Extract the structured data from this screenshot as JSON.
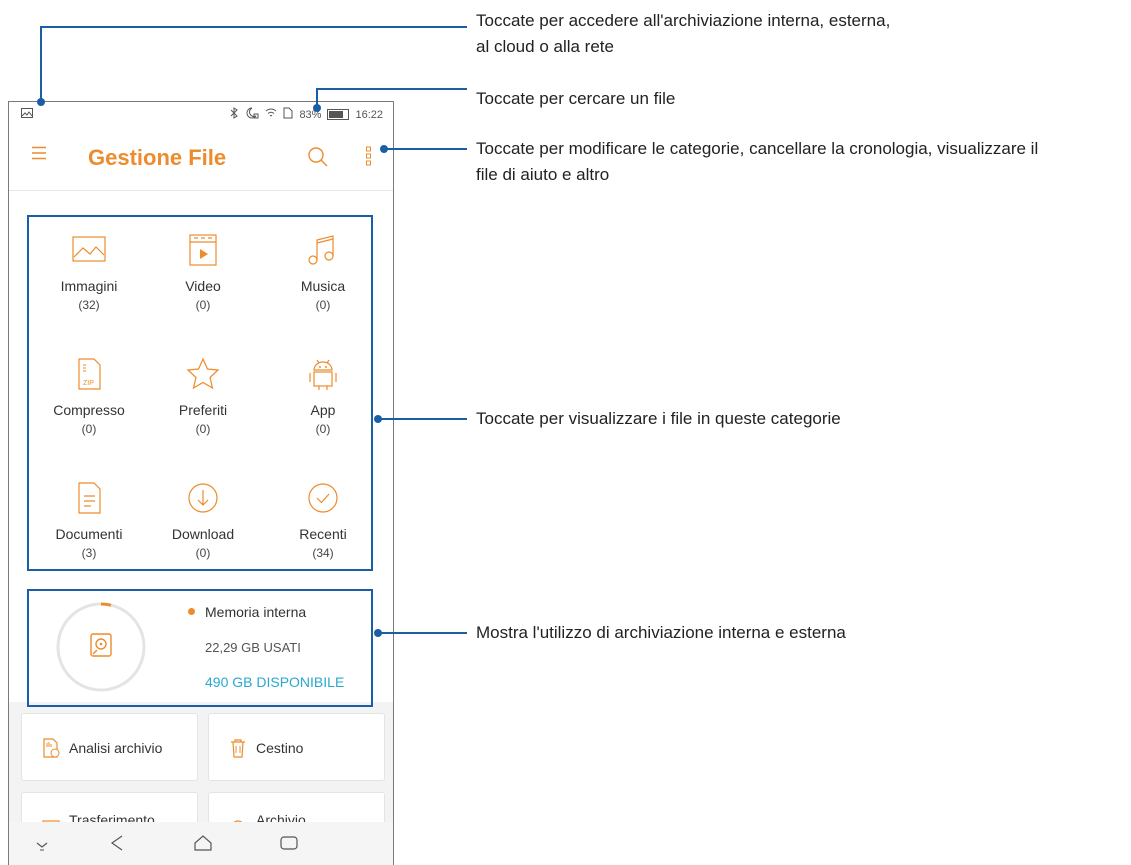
{
  "status": {
    "battery": "83%",
    "time": "16:22"
  },
  "appbar": {
    "title": "Gestione File"
  },
  "categories": [
    {
      "name": "Immagini",
      "count": "(32)",
      "icon": "image-icon"
    },
    {
      "name": "Video",
      "count": "(0)",
      "icon": "video-icon"
    },
    {
      "name": "Musica",
      "count": "(0)",
      "icon": "music-icon"
    },
    {
      "name": "Compresso",
      "count": "(0)",
      "icon": "zip-icon"
    },
    {
      "name": "Preferiti",
      "count": "(0)",
      "icon": "star-icon"
    },
    {
      "name": "App",
      "count": "(0)",
      "icon": "android-icon"
    },
    {
      "name": "Documenti",
      "count": "(3)",
      "icon": "document-icon"
    },
    {
      "name": "Download",
      "count": "(0)",
      "icon": "download-icon"
    },
    {
      "name": "Recenti",
      "count": "(34)",
      "icon": "recent-icon"
    }
  ],
  "storage": {
    "title": "Memoria interna",
    "used": "22,29 GB USATI",
    "free": "490 GB DISPONIBILE"
  },
  "tools": [
    {
      "label": "Analisi archivio",
      "icon": "storage-analysis-icon"
    },
    {
      "label": "Cestino",
      "icon": "trash-icon"
    },
    {
      "label": "Trasferimento",
      "icon": "transfer-icon"
    },
    {
      "label": "Archivio",
      "icon": "archive-icon"
    }
  ],
  "annotations": {
    "storage_access": "Toccate per accedere all'archiviazione interna, esterna,",
    "storage_access_2": "al cloud o alla rete",
    "search": "Toccate per cercare un file",
    "more": "Toccate per modificare le categorie, cancellare la cronologia, visualizzare il",
    "more_2": "file di aiuto e altro",
    "categories": "Toccate per visualizzare i file in queste categorie",
    "storage": "Mostra l'utilizzo di archiviazione interna e esterna"
  },
  "colors": {
    "accent": "#ec8c2c",
    "callout": "#1a5fa3",
    "free_text": "#2aa8cf"
  }
}
